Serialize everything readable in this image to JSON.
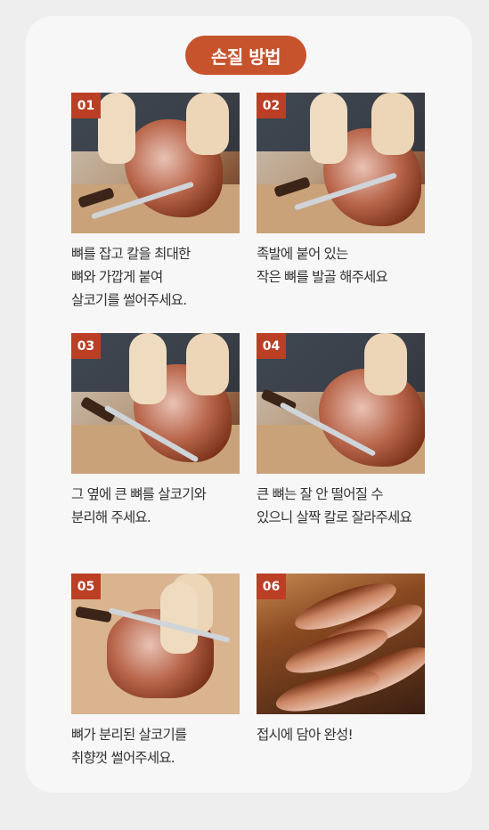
{
  "title": "손질 방법",
  "steps": [
    {
      "number": "01",
      "lines": [
        "뼈를 잡고 칼을 최대한",
        "뼈와 가깝게 붙여",
        "살코기를 썰어주세요."
      ]
    },
    {
      "number": "02",
      "lines": [
        "족발에 붙어 있는",
        "작은 뼈를 발골 해주세요"
      ]
    },
    {
      "number": "03",
      "lines": [
        "그 옆에 큰 뼈를 살코기와",
        "분리해 주세요."
      ]
    },
    {
      "number": "04",
      "lines": [
        "큰 뼈는 잘 안 떨어질 수",
        "있으니 살짝 칼로 잘라주세요"
      ]
    },
    {
      "number": "05",
      "lines": [
        "뼈가 분리된 살코기를",
        "취향껏 썰어주세요."
      ]
    },
    {
      "number": "06",
      "lines": [
        "접시에 담아 완성!"
      ]
    }
  ]
}
